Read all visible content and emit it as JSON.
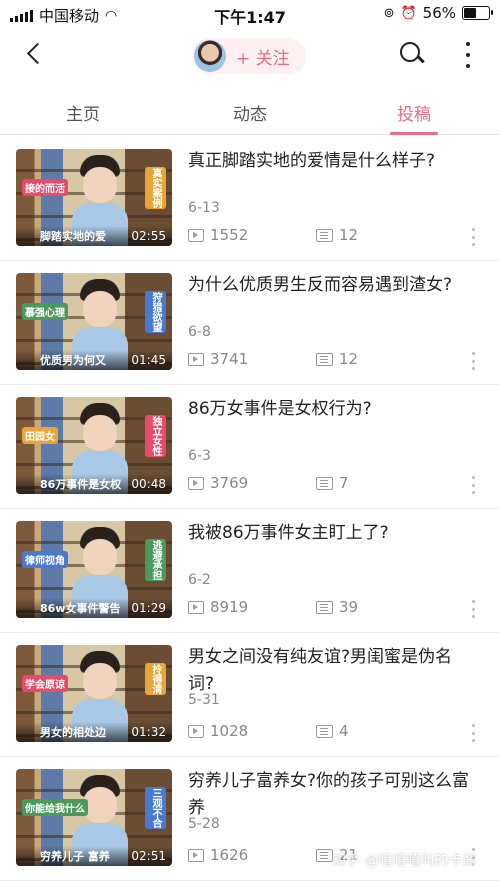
{
  "status_bar": {
    "carrier": "中国移动",
    "time": "下午1:47",
    "battery_percent": "56%",
    "battery_level": 0.56
  },
  "header": {
    "follow_label": "+ 关注"
  },
  "tabs": [
    {
      "label": "主页",
      "active": false
    },
    {
      "label": "动态",
      "active": false
    },
    {
      "label": "投稿",
      "active": true
    }
  ],
  "accent_color": "#f06a86",
  "videos": [
    {
      "title": "真正脚踏实地的爱情是什么样子?",
      "date": "6-13",
      "views": "1552",
      "comments": "12",
      "duration": "02:55",
      "thumb_caption": "脚踏实地的爱",
      "thumb_tags": [
        "接的而活",
        "真实案例"
      ]
    },
    {
      "title": "为什么优质男生反而容易遇到渣女?",
      "date": "6-8",
      "views": "3741",
      "comments": "12",
      "duration": "01:45",
      "thumb_caption": "优质男为何又",
      "thumb_tags": [
        "慕强心理",
        "狩猎欲望"
      ]
    },
    {
      "title": "86万女事件是女权行为?",
      "date": "6-3",
      "views": "3769",
      "comments": "7",
      "duration": "00:48",
      "thumb_caption": "86万事件是女权",
      "thumb_tags": [
        "田园女",
        "独立女性"
      ]
    },
    {
      "title": "我被86万事件女主盯上了?",
      "date": "6-2",
      "views": "8919",
      "comments": "39",
      "duration": "01:29",
      "thumb_caption": "86w女事件警告",
      "thumb_tags": [
        "律师视角",
        "逃避承担"
      ]
    },
    {
      "title": "男女之间没有纯友谊?男闺蜜是伪名词?",
      "date": "5-31",
      "views": "1028",
      "comments": "4",
      "duration": "01:32",
      "thumb_caption": "男女的相处边",
      "thumb_tags": [
        "学会原谅",
        "拎得清"
      ]
    },
    {
      "title": "穷养儿子富养女?你的孩子可别这么富养",
      "date": "5-28",
      "views": "1626",
      "comments": "21",
      "duration": "02:51",
      "thumb_caption": "穷养儿子 富养",
      "thumb_tags": [
        "你能给我什么",
        "三观不合"
      ]
    }
  ],
  "watermark": "知乎 @嘻嘻嘻叫的卡酱"
}
